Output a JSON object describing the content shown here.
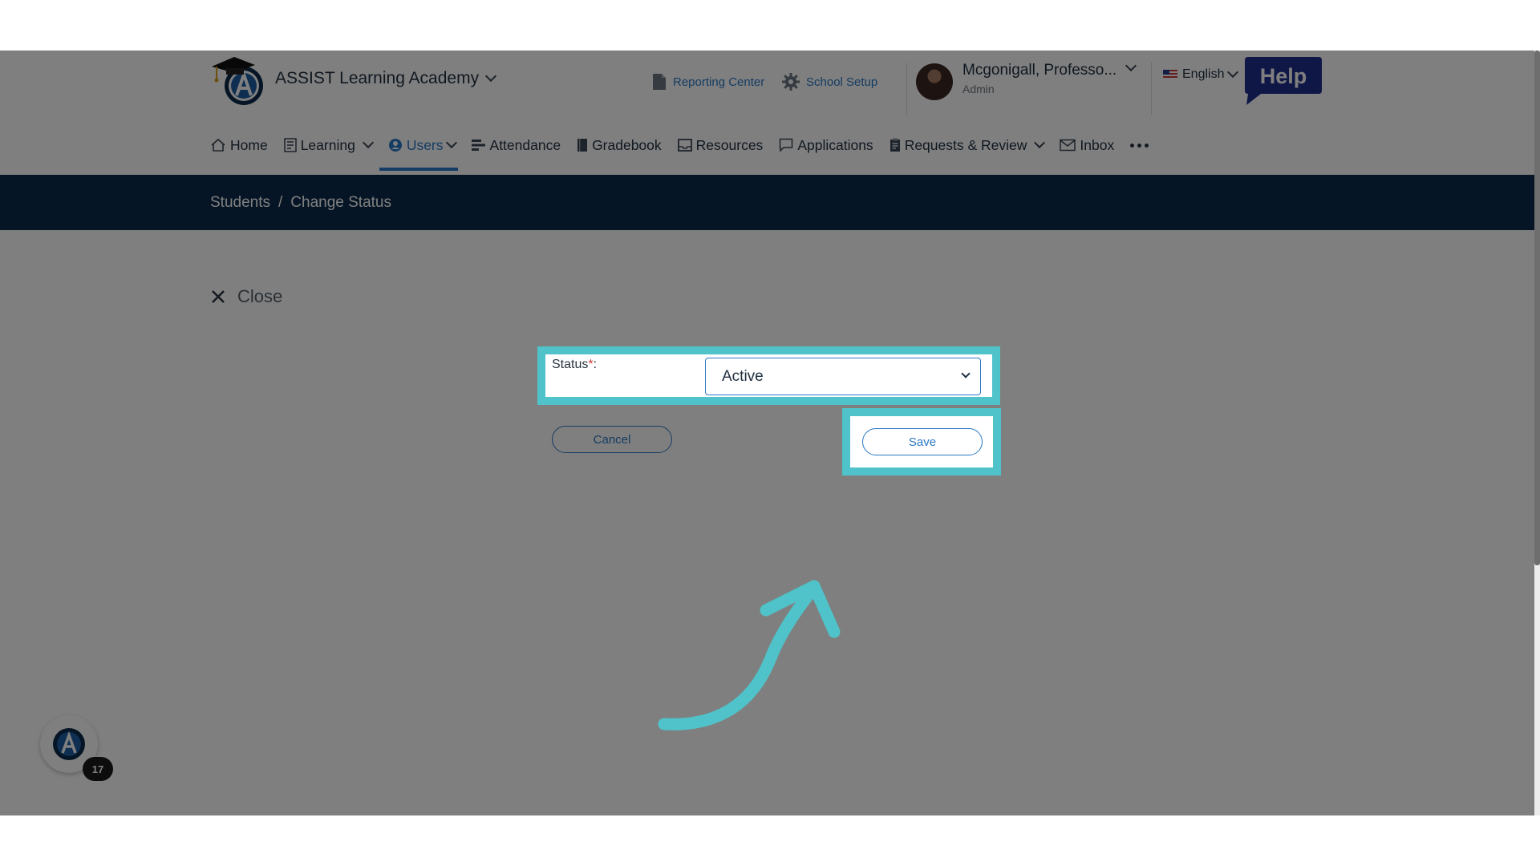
{
  "header": {
    "school_name": "ASSIST Learning Academy",
    "reporting_center": "Reporting Center",
    "school_setup": "School Setup",
    "user_name": "Mcgonigall, Professo...",
    "user_role": "Admin",
    "language": "English",
    "help_label": "Help"
  },
  "menu": {
    "items": [
      {
        "label": "Home",
        "icon": "home-icon"
      },
      {
        "label": "Learning",
        "icon": "learning-icon"
      },
      {
        "label": "Users",
        "icon": "user-circle-icon"
      },
      {
        "label": "Attendance",
        "icon": "attendance-icon"
      },
      {
        "label": "Gradebook",
        "icon": "book-icon"
      },
      {
        "label": "Resources",
        "icon": "tray-icon"
      },
      {
        "label": "Applications",
        "icon": "chat-icon"
      },
      {
        "label": "Requests & Review",
        "icon": "clipboard-icon"
      },
      {
        "label": "Inbox",
        "icon": "mail-icon"
      }
    ],
    "active": "Users"
  },
  "breadcrumb": {
    "parent": "Students",
    "separator": "/",
    "current": "Change Status"
  },
  "content": {
    "close_label": "Close",
    "status_label": "Status",
    "required_mark": "*",
    "status_suffix": ":",
    "status_value": "Active",
    "cancel_label": "Cancel",
    "save_label": "Save"
  },
  "assistant": {
    "count": "17"
  },
  "colors": {
    "accent": "#2a78c4",
    "highlight": "#4fc3c9",
    "navy": "#0b2a4a",
    "overlay": "rgba(0,0,0,0.5)"
  }
}
